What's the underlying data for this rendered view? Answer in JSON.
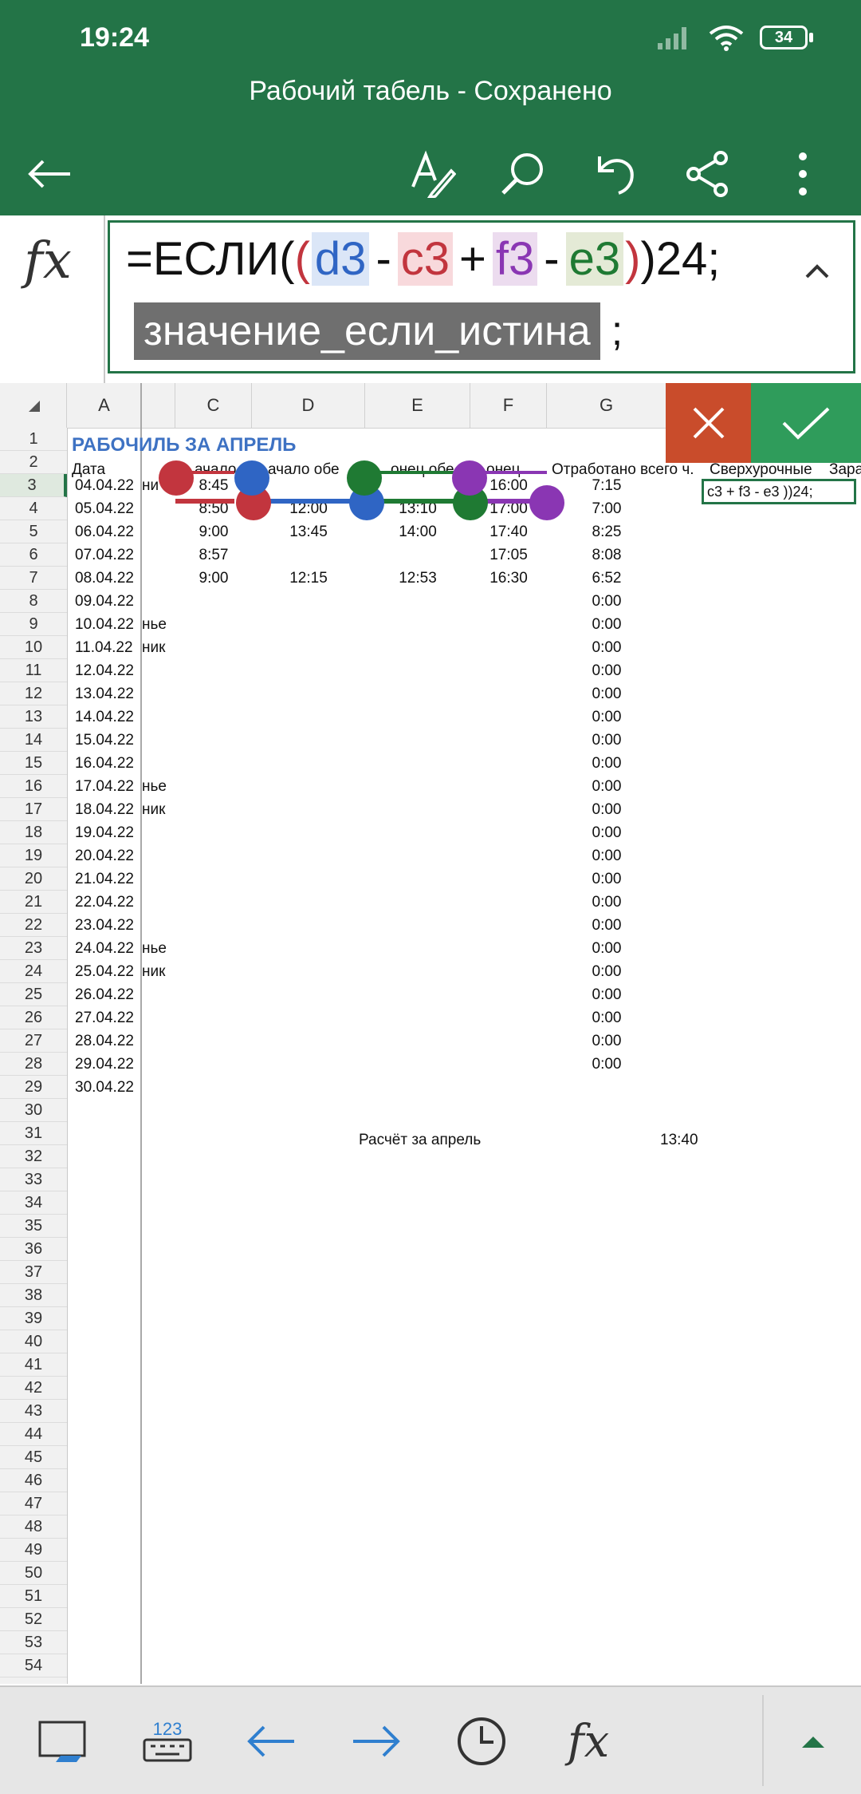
{
  "status": {
    "time": "19:24",
    "battery": "34"
  },
  "app": {
    "title": "Рабочий табель - Сохранено"
  },
  "toolbar": {
    "icons": [
      "back-arrow-icon",
      "pen-icon",
      "search-icon",
      "undo-icon",
      "share-icon",
      "more-icon"
    ]
  },
  "formula": {
    "fx_label": "fx",
    "prefix": "=ЕСЛИ(",
    "open_paren": "(",
    "ref1": "d3",
    "op1": "-",
    "ref2": "c3",
    "op2": "+",
    "ref3": "f3",
    "op3": "-",
    "ref4": "e3",
    "close_paren": ")",
    "suffix": ")24;",
    "hint": "значение_если_истина",
    "hint_suffix": ";"
  },
  "grid": {
    "columns": [
      "A",
      "C",
      "D",
      "E",
      "F",
      "G"
    ],
    "title": "РАБОЧИЛЬ ЗА АПРЕЛЬ",
    "headers": {
      "date": "Дата",
      "b": "ни",
      "c": "ачало",
      "d": "ачало обе",
      "e": "онец обе",
      "f": "онец",
      "g": "Отработано всего ч.",
      "h": "Сверхурочные",
      "i": "Зара"
    },
    "rows": [
      {
        "n": "3",
        "date": "04.04.22",
        "b": "ни",
        "c": "8:45",
        "d": "",
        "e": "",
        "f": "16:00",
        "g": "7:15"
      },
      {
        "n": "4",
        "date": "05.04.22",
        "b": "",
        "c": "8:50",
        "d": "12:00",
        "e": "13:10",
        "f": "17:00",
        "g": "7:00"
      },
      {
        "n": "5",
        "date": "06.04.22",
        "b": "",
        "c": "9:00",
        "d": "13:45",
        "e": "14:00",
        "f": "17:40",
        "g": "8:25"
      },
      {
        "n": "6",
        "date": "07.04.22",
        "b": "",
        "c": "8:57",
        "d": "",
        "e": "",
        "f": "17:05",
        "g": "8:08"
      },
      {
        "n": "7",
        "date": "08.04.22",
        "b": "",
        "c": "9:00",
        "d": "12:15",
        "e": "12:53",
        "f": "16:30",
        "g": "6:52"
      },
      {
        "n": "8",
        "date": "09.04.22",
        "b": "",
        "c": "",
        "d": "",
        "e": "",
        "f": "",
        "g": "0:00"
      },
      {
        "n": "9",
        "date": "10.04.22",
        "b": "нье",
        "c": "",
        "d": "",
        "e": "",
        "f": "",
        "g": "0:00"
      },
      {
        "n": "10",
        "date": "11.04.22",
        "b": "ник",
        "c": "",
        "d": "",
        "e": "",
        "f": "",
        "g": "0:00"
      },
      {
        "n": "11",
        "date": "12.04.22",
        "b": "",
        "c": "",
        "d": "",
        "e": "",
        "f": "",
        "g": "0:00"
      },
      {
        "n": "12",
        "date": "13.04.22",
        "b": "",
        "c": "",
        "d": "",
        "e": "",
        "f": "",
        "g": "0:00"
      },
      {
        "n": "13",
        "date": "14.04.22",
        "b": "",
        "c": "",
        "d": "",
        "e": "",
        "f": "",
        "g": "0:00"
      },
      {
        "n": "14",
        "date": "15.04.22",
        "b": "",
        "c": "",
        "d": "",
        "e": "",
        "f": "",
        "g": "0:00"
      },
      {
        "n": "15",
        "date": "16.04.22",
        "b": "",
        "c": "",
        "d": "",
        "e": "",
        "f": "",
        "g": "0:00"
      },
      {
        "n": "16",
        "date": "17.04.22",
        "b": "нье",
        "c": "",
        "d": "",
        "e": "",
        "f": "",
        "g": "0:00"
      },
      {
        "n": "17",
        "date": "18.04.22",
        "b": "ник",
        "c": "",
        "d": "",
        "e": "",
        "f": "",
        "g": "0:00"
      },
      {
        "n": "18",
        "date": "19.04.22",
        "b": "",
        "c": "",
        "d": "",
        "e": "",
        "f": "",
        "g": "0:00"
      },
      {
        "n": "19",
        "date": "20.04.22",
        "b": "",
        "c": "",
        "d": "",
        "e": "",
        "f": "",
        "g": "0:00"
      },
      {
        "n": "20",
        "date": "21.04.22",
        "b": "",
        "c": "",
        "d": "",
        "e": "",
        "f": "",
        "g": "0:00"
      },
      {
        "n": "21",
        "date": "22.04.22",
        "b": "",
        "c": "",
        "d": "",
        "e": "",
        "f": "",
        "g": "0:00"
      },
      {
        "n": "22",
        "date": "23.04.22",
        "b": "",
        "c": "",
        "d": "",
        "e": "",
        "f": "",
        "g": "0:00"
      },
      {
        "n": "23",
        "date": "24.04.22",
        "b": "нье",
        "c": "",
        "d": "",
        "e": "",
        "f": "",
        "g": "0:00"
      },
      {
        "n": "24",
        "date": "25.04.22",
        "b": "ник",
        "c": "",
        "d": "",
        "e": "",
        "f": "",
        "g": "0:00"
      },
      {
        "n": "25",
        "date": "26.04.22",
        "b": "",
        "c": "",
        "d": "",
        "e": "",
        "f": "",
        "g": "0:00"
      },
      {
        "n": "26",
        "date": "27.04.22",
        "b": "",
        "c": "",
        "d": "",
        "e": "",
        "f": "",
        "g": "0:00"
      },
      {
        "n": "27",
        "date": "28.04.22",
        "b": "",
        "c": "",
        "d": "",
        "e": "",
        "f": "",
        "g": "0:00"
      },
      {
        "n": "28",
        "date": "29.04.22",
        "b": "",
        "c": "",
        "d": "",
        "e": "",
        "f": "",
        "g": "0:00"
      },
      {
        "n": "29",
        "date": "30.04.22",
        "b": "",
        "c": "",
        "d": "",
        "e": "",
        "f": "",
        "g": ""
      }
    ],
    "summary": {
      "label": "Расчёт за апрель",
      "value": "13:40"
    },
    "selected_cell_text": "c3 + f3 - e3 ))24;",
    "row_numbers": [
      "1",
      "2",
      "3",
      "4",
      "5",
      "6",
      "7",
      "8",
      "9",
      "10",
      "11",
      "12",
      "13",
      "14",
      "15",
      "16",
      "17",
      "18",
      "19",
      "20",
      "21",
      "22",
      "23",
      "24",
      "25",
      "26",
      "27",
      "28",
      "29",
      "30",
      "31",
      "32",
      "33",
      "34",
      "35",
      "36",
      "37",
      "38",
      "39",
      "40",
      "41",
      "42",
      "43",
      "44",
      "45",
      "46",
      "47",
      "48",
      "49",
      "50",
      "51",
      "52",
      "53",
      "54"
    ]
  },
  "bottom": {
    "icons": [
      "sheet-view-icon",
      "keyboard-123-icon",
      "left-arrow-icon",
      "right-arrow-icon",
      "clock-icon",
      "fx-icon",
      "expand-up-icon"
    ],
    "keyboard_label": "123",
    "fx_label": "fx"
  },
  "colors": {
    "green": "#237447",
    "blue": "#2f65c4",
    "red": "#c2353e",
    "purple": "#8a36b3",
    "darkgreen": "#1f7a33",
    "cancel": "#c94c2b",
    "ok": "#2f9c5b"
  }
}
